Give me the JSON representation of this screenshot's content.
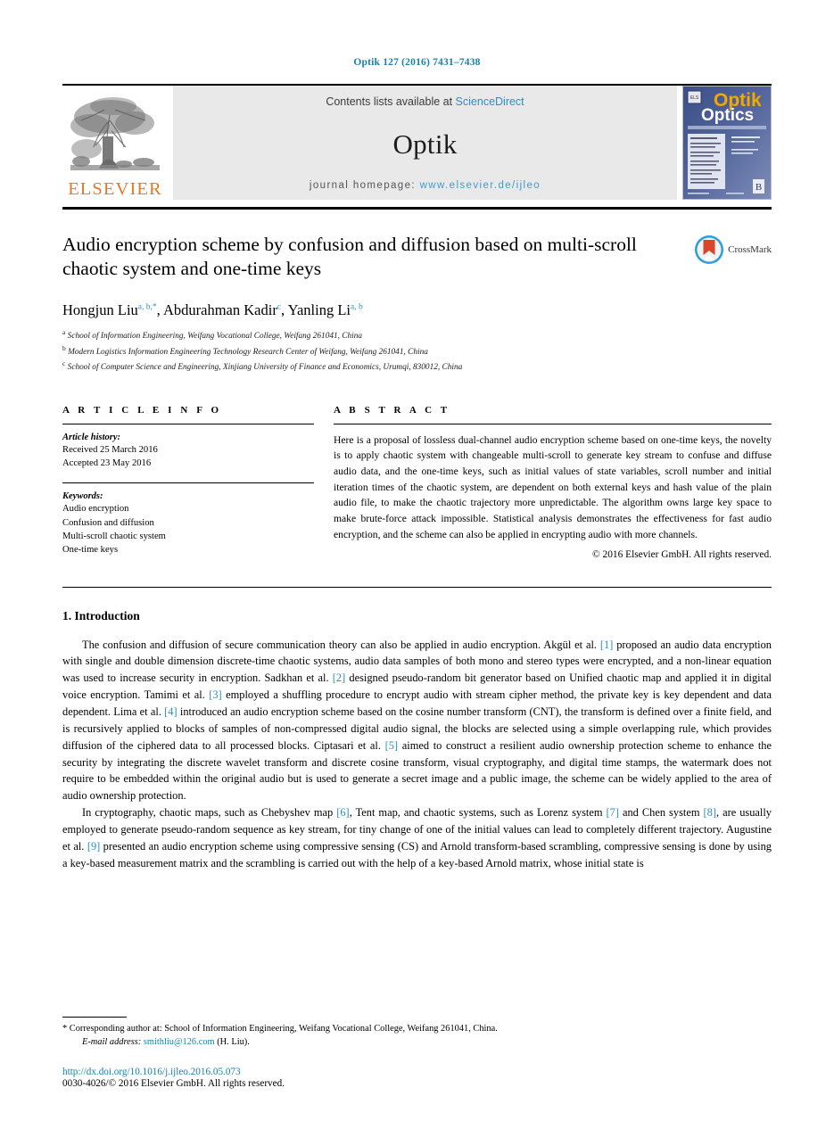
{
  "running_head": "Optik 127 (2016) 7431–7438",
  "masthead": {
    "contents_prefix": "Contents lists available at ",
    "sciencedirect": "ScienceDirect",
    "journal_name": "Optik",
    "homepage_prefix": "journal homepage:",
    "homepage_url": "www.elsevier.de/ijleo",
    "publisher": "ELSEVIER",
    "cover": {
      "title_top": "Optik",
      "title_bottom": "Optics"
    },
    "accent_link_color": "#2a8fc4",
    "publisher_color": "#E87722"
  },
  "article": {
    "title": "Audio encryption scheme by confusion and diffusion based on multi-scroll chaotic system and one-time keys",
    "crossmark_label": "CrossMark",
    "authors_html": "Hongjun Liu<sup>a, b,</sup><sup>*</sup>, Abdurahman Kadir<sup>c</sup>, Yanling Li<sup>a, b</sup>",
    "affiliations": [
      {
        "marker": "a",
        "text": "School of Information Engineering, Weifang Vocational College, Weifang 261041, China"
      },
      {
        "marker": "b",
        "text": "Modern Logistics Information Engineering Technology Research Center of Weifang, Weifang 261041, China"
      },
      {
        "marker": "c",
        "text": "School of Computer Science and Engineering, Xinjiang University of Finance and Economics, Urumqi, 830012, China"
      }
    ]
  },
  "article_info": {
    "section_label": "A R T I C L E   I N F O",
    "history_title": "Article history:",
    "history": [
      "Received 25 March 2016",
      "Accepted 23 May 2016"
    ],
    "keywords_title": "Keywords:",
    "keywords": [
      "Audio encryption",
      "Confusion and diffusion",
      "Multi-scroll chaotic system",
      "One-time keys"
    ]
  },
  "abstract": {
    "section_label": "A B S T R A C T",
    "text": "Here is a proposal of lossless dual-channel audio encryption scheme based on one-time keys, the novelty is to apply chaotic system with changeable multi-scroll to generate key stream to confuse and diffuse audio data, and the one-time keys, such as initial values of state variables, scroll number and initial iteration times of the chaotic system, are dependent on both external keys and hash value of the plain audio file, to make the chaotic trajectory more unpredictable. The algorithm owns large key space to make brute-force attack impossible. Statistical analysis demonstrates the effectiveness for fast audio encryption, and the scheme can also be applied in encrypting audio with more channels.",
    "copyright": "© 2016 Elsevier GmbH. All rights reserved."
  },
  "introduction": {
    "heading": "1.  Introduction",
    "paragraph1_html": "The confusion and diffusion of secure communication theory can also be applied in audio encryption. Akgül et al. <span class=\"ref\">[1]</span> proposed an audio data encryption with single and double dimension discrete-time chaotic systems, audio data samples of both mono and stereo types were encrypted, and a non-linear equation was used to increase security in encryption. Sadkhan et al. <span class=\"ref\">[2]</span> designed pseudo-random bit generator based on Unified chaotic map and applied it in digital voice encryption. Tamimi et al. <span class=\"ref\">[3]</span> employed a shuffling procedure to encrypt audio with stream cipher method, the private key is key dependent and data dependent. Lima et al. <span class=\"ref\">[4]</span> introduced an audio encryption scheme based on the cosine number transform (CNT), the transform is defined over a finite field, and is recursively applied to blocks of samples of non-compressed digital audio signal, the blocks are selected using a simple overlapping rule, which provides diffusion of the ciphered data to all processed blocks. Ciptasari et al. <span class=\"ref\">[5]</span> aimed to construct a resilient audio ownership protection scheme to enhance the security by integrating the discrete wavelet transform and discrete cosine transform, visual cryptography, and digital time stamps, the watermark does not require to be embedded within the original audio but is used to generate a secret image and a public image, the scheme can be widely applied to the area of audio ownership protection.",
    "paragraph2_html": "In cryptography, chaotic maps, such as Chebyshev map <span class=\"ref\">[6]</span>, Tent map, and chaotic systems, such as Lorenz system <span class=\"ref\">[7]</span> and Chen system <span class=\"ref\">[8]</span>, are usually employed to generate pseudo-random sequence as key stream, for tiny change of one of the initial values can lead to completely different trajectory. Augustine et al. <span class=\"ref\">[9]</span> presented an audio encryption scheme using compressive sensing (CS) and Arnold transform-based scrambling, compressive sensing is done by using a key-based measurement matrix and the scrambling is carried out with the help of a key-based Arnold matrix, whose initial state is"
  },
  "footnotes": {
    "corresponding_html": "*  Corresponding author at: School of Information Engineering, Weifang Vocational College, Weifang 261041, China.",
    "email_label": "E-mail address:",
    "email": "smithliu@126.com",
    "email_suffix": "(H. Liu).",
    "doi": "http://dx.doi.org/10.1016/j.ijleo.2016.05.073",
    "issn_line": "0030-4026/© 2016 Elsevier GmbH. All rights reserved."
  }
}
